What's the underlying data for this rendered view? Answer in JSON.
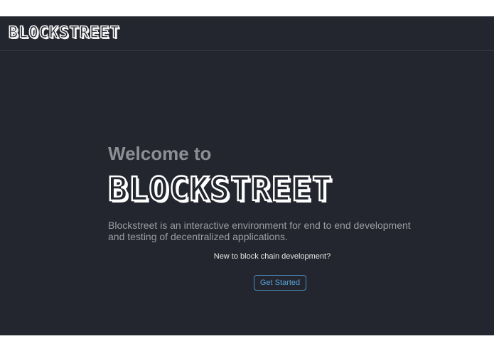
{
  "header": {
    "logo_text": "BLOCKSTREET"
  },
  "hero": {
    "welcome": "Welcome to",
    "brand": "BLOCKSTREET",
    "tagline": "Blockstreet is an interactive environment for end to end development and testing of decentralized applications.",
    "prompt": "New to block chain development?",
    "cta_label": "Get Started"
  },
  "colors": {
    "background": "#23262e",
    "accent": "#5aa0d8",
    "muted_text": "#9a9da3"
  }
}
